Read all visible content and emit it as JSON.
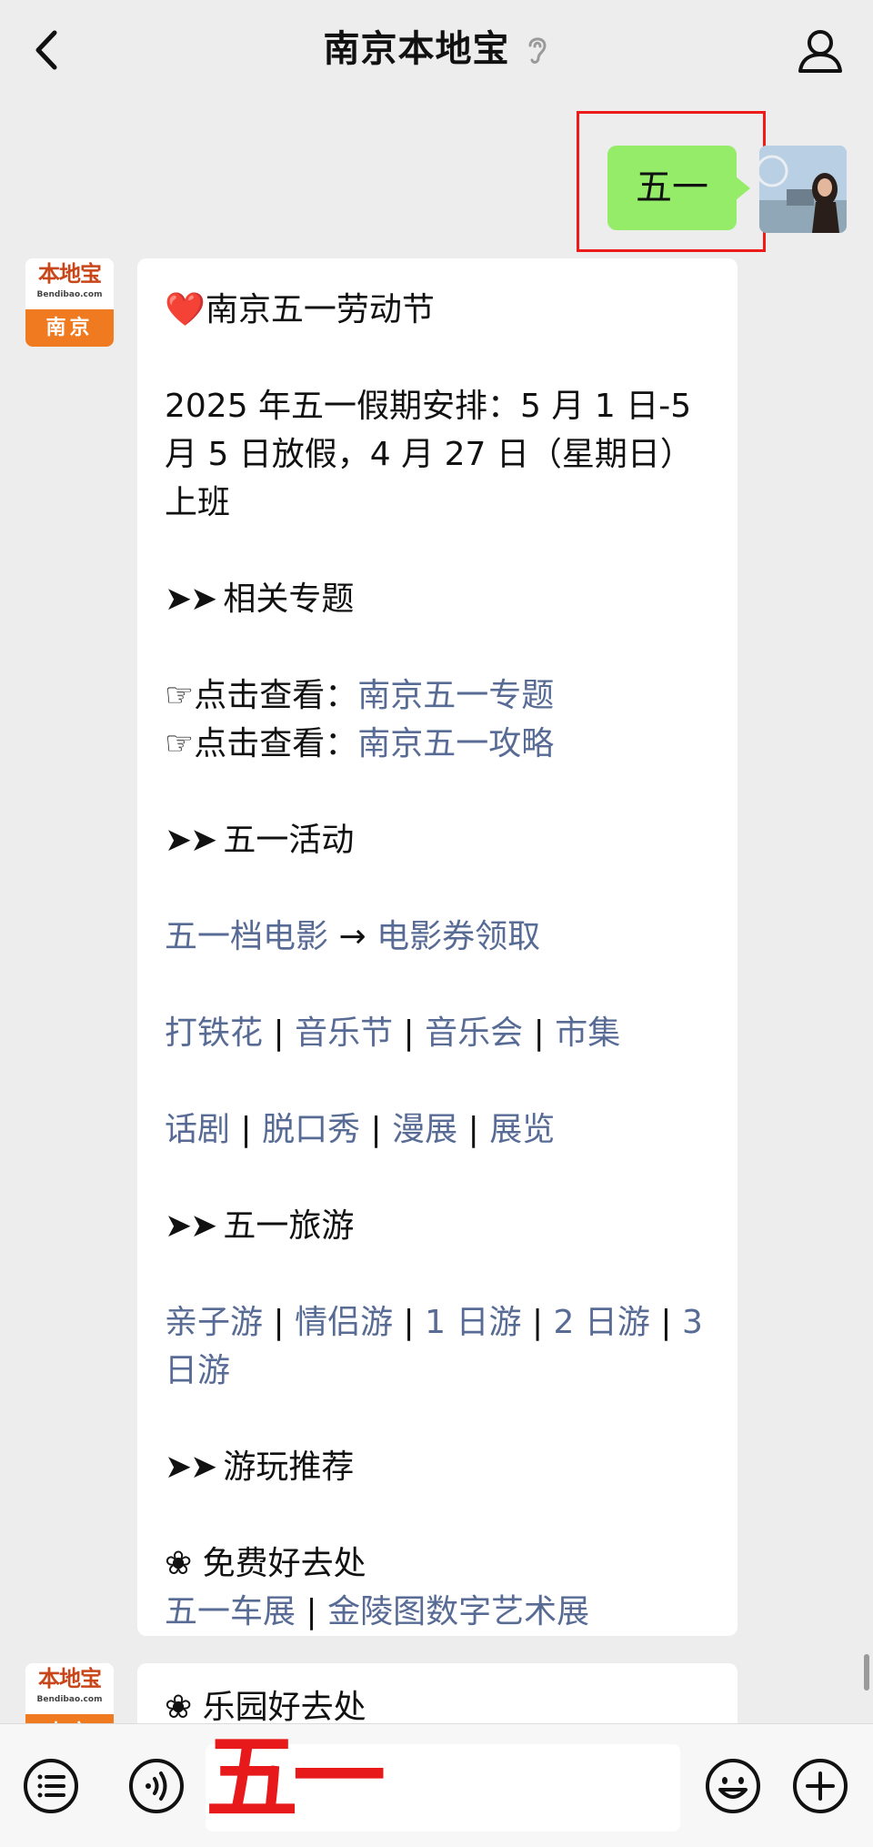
{
  "header": {
    "title": "南京本地宝"
  },
  "outgoing": {
    "text": "五一"
  },
  "bot": {
    "logo_text": "本地宝",
    "logo_sub": "Bendibao.com",
    "logo_city": "南京"
  },
  "card1": {
    "heading_icon": "❤️",
    "heading": "南京五一劳动节",
    "schedule": "2025 年五一假期安排：5 月 1 日-5 月 5 日放假，4 月 27 日（星期日）上班",
    "section_topics": "相关专题",
    "topic_rows": [
      {
        "prefix": "点击查看：",
        "link": "南京五一专题"
      },
      {
        "prefix": "点击查看：",
        "link": "南京五一攻略"
      }
    ],
    "section_activities": "五一活动",
    "movie_link_1": "五一档电影",
    "movie_arrow": "→",
    "movie_link_2": "电影券领取",
    "activity_row_1": [
      "打铁花",
      "音乐节",
      "音乐会",
      "市集"
    ],
    "activity_row_2": [
      "话剧",
      "脱口秀",
      "漫展",
      "展览"
    ],
    "section_travel": "五一旅游",
    "travel_links": [
      "亲子游",
      "情侣游",
      "1 日游",
      "2 日游",
      "3 日游"
    ],
    "section_recommend": "游玩推荐",
    "free_places_title": "免费好去处",
    "free_places_links": [
      "五一车展",
      "金陵图数字艺术展"
    ]
  },
  "card2": {
    "title": "乐园好去处"
  },
  "input": {
    "typed_text": "五一"
  },
  "symbols": {
    "arrows": "➤➤",
    "pointer": "☞",
    "flower": "❀",
    "separator": "|"
  },
  "colors": {
    "link": "#576b95",
    "bubble": "#95ec69",
    "highlight": "#ee1b1b",
    "typed_text": "#e8191a"
  }
}
